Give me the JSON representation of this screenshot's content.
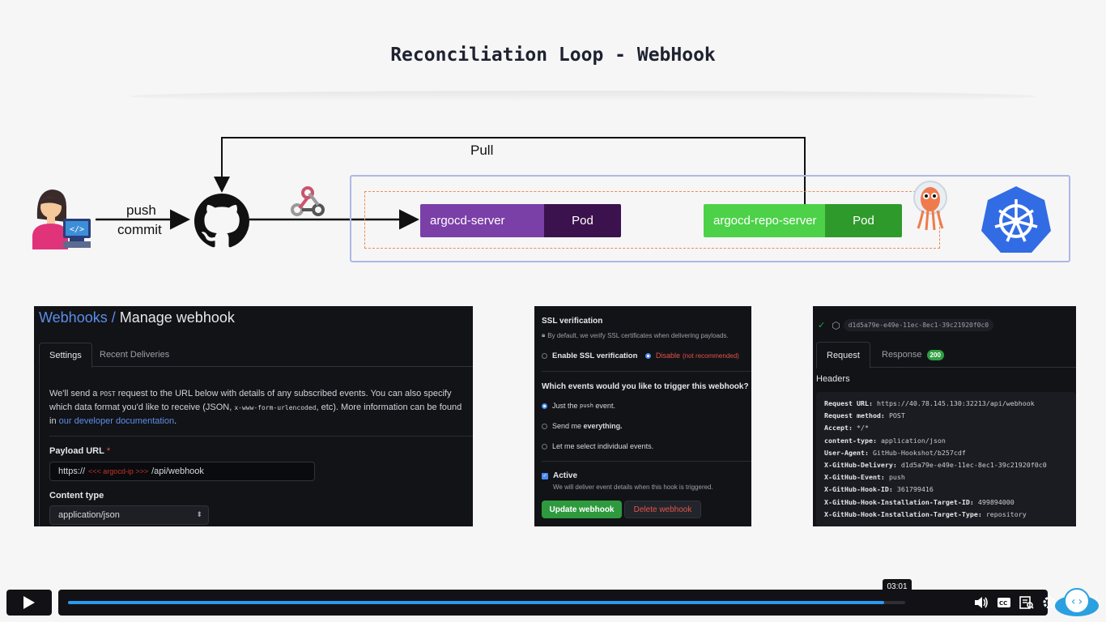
{
  "slide": {
    "title": "Reconciliation Loop - WebHook"
  },
  "diagram": {
    "push_label": "push",
    "commit_label": "commit",
    "pull_label": "Pull",
    "server_pod": {
      "name": "argocd-server",
      "tag": "Pod",
      "name_color": "#7b3fa8",
      "tag_color": "#3b124e"
    },
    "repo_pod": {
      "name": "argocd-repo-server",
      "tag": "Pod",
      "name_color": "#4cd148",
      "tag_color": "#2f9a2c"
    },
    "icons": [
      "developer-icon",
      "github-icon",
      "webhook-icon",
      "argo-mascot-icon",
      "kubernetes-icon"
    ]
  },
  "webhook_panel": {
    "crumb": "Webhooks /",
    "title": "Manage webhook",
    "tab_settings": "Settings",
    "tab_deliveries": "Recent Deliveries",
    "desc_1": "We'll send a ",
    "desc_post": "POST",
    "desc_2": " request to the URL below with details of any subscribed events. You can also specify which data format you'd like to receive (JSON, ",
    "desc_mono": "x-www-form-urlencoded",
    "desc_3": ", etc). More information can be found in ",
    "desc_link": "our developer documentation",
    "desc_4": ".",
    "payload_label": "Payload URL",
    "payload_required": "*",
    "payload_prefix": "https://",
    "payload_placeholder": "<<< argocd-ip >>>",
    "payload_suffix": "/api/webhook",
    "content_type_label": "Content type",
    "content_type_value": "application/json"
  },
  "ssl_panel": {
    "ssl_title": "SSL verification",
    "ssl_desc": "By default, we verify SSL certificates when delivering payloads.",
    "enable_label": "Enable SSL verification",
    "disable_label": "Disable",
    "disable_note": "(not recommended)",
    "events_question": "Which events would you like to trigger this webhook?",
    "opt_push_1": "Just the",
    "opt_push_code": "push",
    "opt_push_2": "event.",
    "opt_everything_1": "Send me",
    "opt_everything_2": "everything.",
    "opt_individual": "Let me select individual events.",
    "active_label": "Active",
    "active_desc": "We will deliver event details when this hook is triggered.",
    "update_button": "Update webhook",
    "delete_button": "Delete webhook"
  },
  "delivery_panel": {
    "delivery_id": "d1d5a79e-e49e-11ec-8ec1-39c21920f0c0",
    "tab_request": "Request",
    "tab_response": "Response",
    "response_code": "200",
    "headers_title": "Headers",
    "headers": [
      {
        "key": "Request URL:",
        "value": "https://40.78.145.130:32213/api/webhook"
      },
      {
        "key": "Request method:",
        "value": "POST"
      },
      {
        "key": "Accept:",
        "value": "*/*"
      },
      {
        "key": "content-type:",
        "value": "application/json"
      },
      {
        "key": "User-Agent:",
        "value": "GitHub-Hookshot/b257cdf"
      },
      {
        "key": "X-GitHub-Delivery:",
        "value": "d1d5a79e-e49e-11ec-8ec1-39c21920f0c0"
      },
      {
        "key": "X-GitHub-Event:",
        "value": "push"
      },
      {
        "key": "X-GitHub-Hook-ID:",
        "value": "361799416"
      },
      {
        "key": "X-GitHub-Hook-Installation-Target-ID:",
        "value": "499894000"
      },
      {
        "key": "X-GitHub-Hook-Installation-Target-Type:",
        "value": "repository"
      }
    ]
  },
  "player": {
    "time_tooltip": "03:01",
    "progress": 0.975,
    "accent_color": "#2c9af0",
    "controls": [
      "volume-icon",
      "captions-icon",
      "transcript-icon",
      "settings-icon",
      "pip-icon",
      "fullscreen-exit-icon"
    ]
  }
}
